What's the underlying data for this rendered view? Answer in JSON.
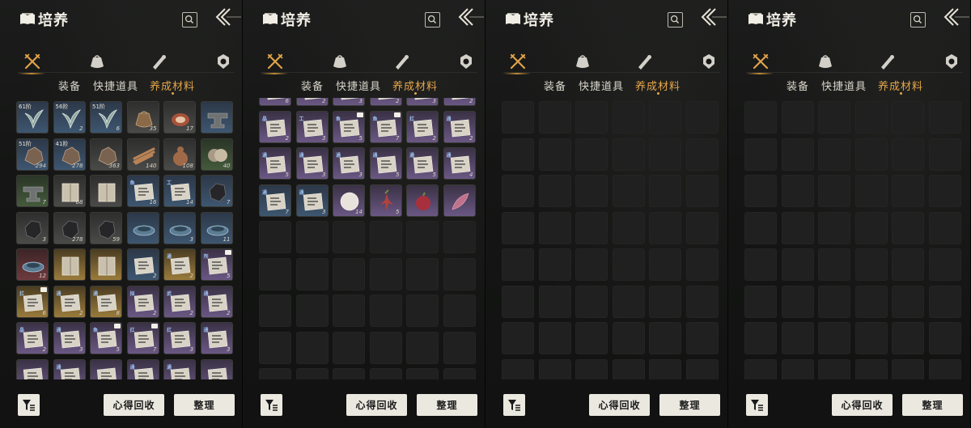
{
  "panels": [
    {
      "title": "培养",
      "categories": [
        "crossed-swords-icon",
        "pouch-icon",
        "scroll-icon",
        "orb-icon"
      ],
      "subtabs": [
        "装备",
        "快捷道具",
        "养成材料"
      ],
      "active_subtab": "养成材料",
      "buttons": {
        "recycle": "心得回收",
        "sort": "整理"
      },
      "scroll_offset_rows": 0,
      "items": [
        {
          "q": "blue",
          "icon": "herb",
          "tier": "61阶"
        },
        {
          "q": "blue",
          "icon": "herb",
          "tier": "56阶",
          "qty": "2"
        },
        {
          "q": "blue",
          "icon": "herb",
          "tier": "51阶",
          "qty": "6"
        },
        {
          "q": "gray",
          "icon": "pouch",
          "qty": "35"
        },
        {
          "q": "gray",
          "icon": "meat",
          "qty": "17"
        },
        {
          "q": "blue",
          "icon": "anvil"
        },
        {
          "q": "blue",
          "icon": "ore",
          "tier": "51阶",
          "qty": "294"
        },
        {
          "q": "blue",
          "icon": "ore",
          "tier": "41阶",
          "qty": "278"
        },
        {
          "q": "gray",
          "icon": "ore",
          "qty": "363"
        },
        {
          "q": "gray",
          "icon": "wood",
          "qty": "140"
        },
        {
          "q": "gray",
          "icon": "gourd",
          "qty": "108"
        },
        {
          "q": "green",
          "icon": "disc",
          "qty": "40"
        },
        {
          "q": "green",
          "icon": "anvil",
          "qty": "7"
        },
        {
          "q": "gray",
          "icon": "book",
          "qty": "68"
        },
        {
          "q": "gray",
          "icon": "book"
        },
        {
          "q": "blue",
          "icon": "manual",
          "tag": "鱼",
          "qty": "16"
        },
        {
          "q": "blue",
          "icon": "manual",
          "tag": "工",
          "qty": "14"
        },
        {
          "q": "blue",
          "icon": "stone",
          "qty": "7"
        },
        {
          "q": "gray",
          "icon": "stone",
          "qty": "3"
        },
        {
          "q": "gray",
          "icon": "stone",
          "qty": "278"
        },
        {
          "q": "gray",
          "icon": "stone",
          "qty": "59"
        },
        {
          "q": "blue",
          "icon": "basin"
        },
        {
          "q": "blue",
          "icon": "basin",
          "qty": "3"
        },
        {
          "q": "blue",
          "icon": "basin",
          "qty": "11"
        },
        {
          "q": "red",
          "icon": "basin",
          "qty": "12"
        },
        {
          "q": "gold",
          "icon": "book"
        },
        {
          "q": "gold",
          "icon": "book"
        },
        {
          "q": "blue",
          "icon": "manual",
          "qty": "2"
        },
        {
          "q": "gold",
          "icon": "manual",
          "tag": "通",
          "qty": "2"
        },
        {
          "q": "purple",
          "icon": "manual",
          "tag": "剂",
          "qty": "5",
          "badge": true
        },
        {
          "q": "gold",
          "icon": "manual",
          "tag": "扛",
          "qty": "6",
          "badge": true
        },
        {
          "q": "gold",
          "icon": "manual",
          "tag": "通",
          "qty": "2"
        },
        {
          "q": "gold",
          "icon": "manual",
          "tag": "通",
          "qty": "8"
        },
        {
          "q": "purple",
          "icon": "manual",
          "tag": "拟",
          "qty": "2"
        },
        {
          "q": "purple",
          "icon": "manual",
          "tag": "武",
          "qty": "2"
        },
        {
          "q": "purple",
          "icon": "manual",
          "tag": "通",
          "qty": "2"
        },
        {
          "q": "purple",
          "icon": "manual",
          "tag": "晶",
          "qty": "2"
        },
        {
          "q": "purple",
          "icon": "manual",
          "tag": "通",
          "qty": "3"
        },
        {
          "q": "purple",
          "icon": "manual",
          "tag": "鱼",
          "qty": "5",
          "badge": true
        },
        {
          "q": "purple",
          "icon": "manual",
          "tag": "扛",
          "qty": "7",
          "badge": true
        },
        {
          "q": "purple",
          "icon": "manual",
          "tag": "扛",
          "qty": "3"
        },
        {
          "q": "purple",
          "icon": "manual",
          "tag": "通",
          "qty": "3"
        },
        {
          "q": "purple",
          "icon": "manual"
        },
        {
          "q": "purple",
          "icon": "manual",
          "tag": "通"
        },
        {
          "q": "purple",
          "icon": "manual"
        },
        {
          "q": "purple",
          "icon": "manual",
          "tag": "通"
        },
        {
          "q": "purple",
          "icon": "manual",
          "tag": "通"
        },
        {
          "q": "purple",
          "icon": "manual"
        }
      ]
    },
    {
      "title": "培养",
      "categories": [
        "crossed-swords-icon",
        "pouch-icon",
        "scroll-icon",
        "orb-icon"
      ],
      "subtabs": [
        "装备",
        "快捷道具",
        "养成材料"
      ],
      "active_subtab": "养成材料",
      "buttons": {
        "recycle": "心得回收",
        "sort": "整理"
      },
      "scroll_offset_rows": 0,
      "items": [
        {
          "q": "purple",
          "icon": "manual",
          "qty": "6",
          "half": true
        },
        {
          "q": "purple",
          "icon": "manual",
          "qty": "2",
          "half": true
        },
        {
          "q": "purple",
          "icon": "manual",
          "qty": "3",
          "half": true
        },
        {
          "q": "purple",
          "icon": "manual",
          "qty": "2",
          "half": true
        },
        {
          "q": "purple",
          "icon": "manual",
          "qty": "3",
          "half": true
        },
        {
          "q": "purple",
          "icon": "manual",
          "qty": "2",
          "half": true
        },
        {
          "q": "purple",
          "icon": "manual",
          "tag": "晶",
          "qty": "2"
        },
        {
          "q": "purple",
          "icon": "manual",
          "tag": "工",
          "qty": "3"
        },
        {
          "q": "purple",
          "icon": "manual",
          "tag": "鱼",
          "qty": "5",
          "badge": true
        },
        {
          "q": "purple",
          "icon": "manual",
          "tag": "鱼",
          "qty": "7",
          "badge": true
        },
        {
          "q": "purple",
          "icon": "manual",
          "tag": "扛",
          "qty": "2"
        },
        {
          "q": "purple",
          "icon": "manual",
          "tag": "通",
          "qty": "2"
        },
        {
          "q": "purple",
          "icon": "manual",
          "tag": "通",
          "qty": "5"
        },
        {
          "q": "purple",
          "icon": "manual",
          "tag": "通",
          "qty": "3"
        },
        {
          "q": "purple",
          "icon": "manual",
          "tag": "通",
          "qty": "3"
        },
        {
          "q": "purple",
          "icon": "manual",
          "tag": "通",
          "qty": "5"
        },
        {
          "q": "purple",
          "icon": "manual",
          "tag": "通",
          "qty": "5"
        },
        {
          "q": "purple",
          "icon": "manual",
          "tag": "通",
          "qty": "4"
        },
        {
          "q": "blue",
          "icon": "manual",
          "tag": "通",
          "qty": "7"
        },
        {
          "q": "blue",
          "icon": "manual",
          "tag": "通",
          "qty": "3"
        },
        {
          "q": "purple",
          "icon": "pearl",
          "qty": "14"
        },
        {
          "q": "purple",
          "icon": "root",
          "qty": "5"
        },
        {
          "q": "purple",
          "icon": "berry"
        },
        {
          "q": "purple",
          "icon": "petal"
        }
      ]
    },
    {
      "title": "培养",
      "categories": [
        "crossed-swords-icon",
        "pouch-icon",
        "scroll-icon",
        "orb-icon"
      ],
      "subtabs": [
        "装备",
        "快捷道具",
        "养成材料"
      ],
      "active_subtab": "养成材料",
      "buttons": {
        "recycle": "心得回收",
        "sort": "整理"
      },
      "items": []
    },
    {
      "title": "培养",
      "categories": [
        "crossed-swords-icon",
        "pouch-icon",
        "scroll-icon",
        "orb-icon"
      ],
      "subtabs": [
        "装备",
        "快捷道具",
        "养成材料"
      ],
      "active_subtab": "养成材料",
      "buttons": {
        "recycle": "心得回收",
        "sort": "整理"
      },
      "items": []
    }
  ],
  "colors": {
    "accent": "#e5a64a",
    "blue": "#3e5670",
    "purple": "#6a5784",
    "gold": "#9a7b3c",
    "green": "#445a3c",
    "red": "#6e3a3e"
  }
}
